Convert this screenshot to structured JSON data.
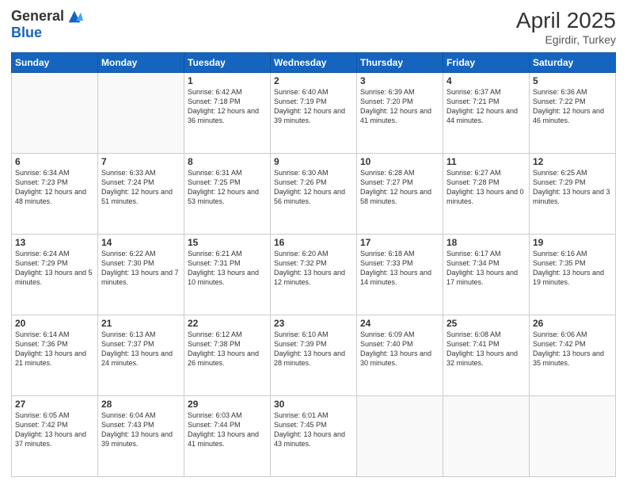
{
  "header": {
    "logo_line1": "General",
    "logo_line2": "Blue",
    "month": "April 2025",
    "location": "Egirdir, Turkey"
  },
  "weekdays": [
    "Sunday",
    "Monday",
    "Tuesday",
    "Wednesday",
    "Thursday",
    "Friday",
    "Saturday"
  ],
  "weeks": [
    [
      {
        "day": "",
        "sunrise": "",
        "sunset": "",
        "daylight": ""
      },
      {
        "day": "",
        "sunrise": "",
        "sunset": "",
        "daylight": ""
      },
      {
        "day": "1",
        "sunrise": "Sunrise: 6:42 AM",
        "sunset": "Sunset: 7:18 PM",
        "daylight": "Daylight: 12 hours and 36 minutes."
      },
      {
        "day": "2",
        "sunrise": "Sunrise: 6:40 AM",
        "sunset": "Sunset: 7:19 PM",
        "daylight": "Daylight: 12 hours and 39 minutes."
      },
      {
        "day": "3",
        "sunrise": "Sunrise: 6:39 AM",
        "sunset": "Sunset: 7:20 PM",
        "daylight": "Daylight: 12 hours and 41 minutes."
      },
      {
        "day": "4",
        "sunrise": "Sunrise: 6:37 AM",
        "sunset": "Sunset: 7:21 PM",
        "daylight": "Daylight: 12 hours and 44 minutes."
      },
      {
        "day": "5",
        "sunrise": "Sunrise: 6:36 AM",
        "sunset": "Sunset: 7:22 PM",
        "daylight": "Daylight: 12 hours and 46 minutes."
      }
    ],
    [
      {
        "day": "6",
        "sunrise": "Sunrise: 6:34 AM",
        "sunset": "Sunset: 7:23 PM",
        "daylight": "Daylight: 12 hours and 48 minutes."
      },
      {
        "day": "7",
        "sunrise": "Sunrise: 6:33 AM",
        "sunset": "Sunset: 7:24 PM",
        "daylight": "Daylight: 12 hours and 51 minutes."
      },
      {
        "day": "8",
        "sunrise": "Sunrise: 6:31 AM",
        "sunset": "Sunset: 7:25 PM",
        "daylight": "Daylight: 12 hours and 53 minutes."
      },
      {
        "day": "9",
        "sunrise": "Sunrise: 6:30 AM",
        "sunset": "Sunset: 7:26 PM",
        "daylight": "Daylight: 12 hours and 56 minutes."
      },
      {
        "day": "10",
        "sunrise": "Sunrise: 6:28 AM",
        "sunset": "Sunset: 7:27 PM",
        "daylight": "Daylight: 12 hours and 58 minutes."
      },
      {
        "day": "11",
        "sunrise": "Sunrise: 6:27 AM",
        "sunset": "Sunset: 7:28 PM",
        "daylight": "Daylight: 13 hours and 0 minutes."
      },
      {
        "day": "12",
        "sunrise": "Sunrise: 6:25 AM",
        "sunset": "Sunset: 7:29 PM",
        "daylight": "Daylight: 13 hours and 3 minutes."
      }
    ],
    [
      {
        "day": "13",
        "sunrise": "Sunrise: 6:24 AM",
        "sunset": "Sunset: 7:29 PM",
        "daylight": "Daylight: 13 hours and 5 minutes."
      },
      {
        "day": "14",
        "sunrise": "Sunrise: 6:22 AM",
        "sunset": "Sunset: 7:30 PM",
        "daylight": "Daylight: 13 hours and 7 minutes."
      },
      {
        "day": "15",
        "sunrise": "Sunrise: 6:21 AM",
        "sunset": "Sunset: 7:31 PM",
        "daylight": "Daylight: 13 hours and 10 minutes."
      },
      {
        "day": "16",
        "sunrise": "Sunrise: 6:20 AM",
        "sunset": "Sunset: 7:32 PM",
        "daylight": "Daylight: 13 hours and 12 minutes."
      },
      {
        "day": "17",
        "sunrise": "Sunrise: 6:18 AM",
        "sunset": "Sunset: 7:33 PM",
        "daylight": "Daylight: 13 hours and 14 minutes."
      },
      {
        "day": "18",
        "sunrise": "Sunrise: 6:17 AM",
        "sunset": "Sunset: 7:34 PM",
        "daylight": "Daylight: 13 hours and 17 minutes."
      },
      {
        "day": "19",
        "sunrise": "Sunrise: 6:16 AM",
        "sunset": "Sunset: 7:35 PM",
        "daylight": "Daylight: 13 hours and 19 minutes."
      }
    ],
    [
      {
        "day": "20",
        "sunrise": "Sunrise: 6:14 AM",
        "sunset": "Sunset: 7:36 PM",
        "daylight": "Daylight: 13 hours and 21 minutes."
      },
      {
        "day": "21",
        "sunrise": "Sunrise: 6:13 AM",
        "sunset": "Sunset: 7:37 PM",
        "daylight": "Daylight: 13 hours and 24 minutes."
      },
      {
        "day": "22",
        "sunrise": "Sunrise: 6:12 AM",
        "sunset": "Sunset: 7:38 PM",
        "daylight": "Daylight: 13 hours and 26 minutes."
      },
      {
        "day": "23",
        "sunrise": "Sunrise: 6:10 AM",
        "sunset": "Sunset: 7:39 PM",
        "daylight": "Daylight: 13 hours and 28 minutes."
      },
      {
        "day": "24",
        "sunrise": "Sunrise: 6:09 AM",
        "sunset": "Sunset: 7:40 PM",
        "daylight": "Daylight: 13 hours and 30 minutes."
      },
      {
        "day": "25",
        "sunrise": "Sunrise: 6:08 AM",
        "sunset": "Sunset: 7:41 PM",
        "daylight": "Daylight: 13 hours and 32 minutes."
      },
      {
        "day": "26",
        "sunrise": "Sunrise: 6:06 AM",
        "sunset": "Sunset: 7:42 PM",
        "daylight": "Daylight: 13 hours and 35 minutes."
      }
    ],
    [
      {
        "day": "27",
        "sunrise": "Sunrise: 6:05 AM",
        "sunset": "Sunset: 7:42 PM",
        "daylight": "Daylight: 13 hours and 37 minutes."
      },
      {
        "day": "28",
        "sunrise": "Sunrise: 6:04 AM",
        "sunset": "Sunset: 7:43 PM",
        "daylight": "Daylight: 13 hours and 39 minutes."
      },
      {
        "day": "29",
        "sunrise": "Sunrise: 6:03 AM",
        "sunset": "Sunset: 7:44 PM",
        "daylight": "Daylight: 13 hours and 41 minutes."
      },
      {
        "day": "30",
        "sunrise": "Sunrise: 6:01 AM",
        "sunset": "Sunset: 7:45 PM",
        "daylight": "Daylight: 13 hours and 43 minutes."
      },
      {
        "day": "",
        "sunrise": "",
        "sunset": "",
        "daylight": ""
      },
      {
        "day": "",
        "sunrise": "",
        "sunset": "",
        "daylight": ""
      },
      {
        "day": "",
        "sunrise": "",
        "sunset": "",
        "daylight": ""
      }
    ]
  ]
}
